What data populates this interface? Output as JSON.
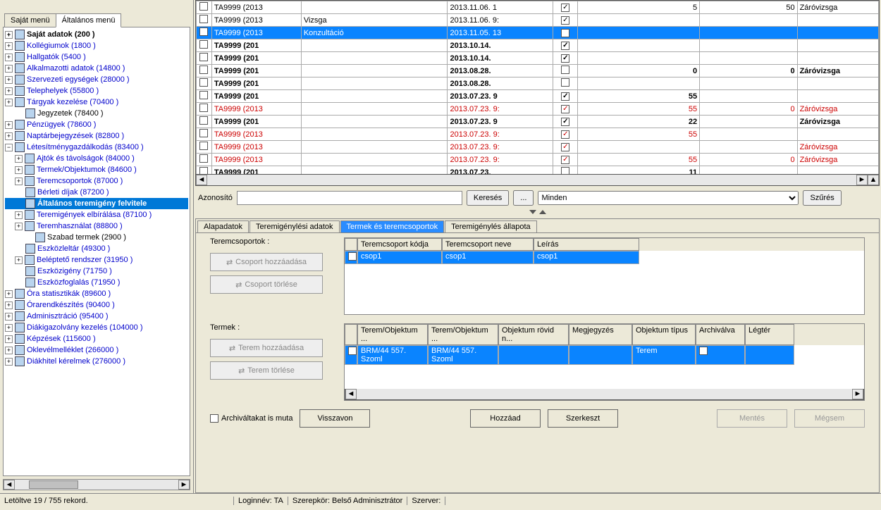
{
  "tabs": {
    "own": "Saját menü",
    "general": "Általános menü"
  },
  "tree": [
    {
      "d": 0,
      "e": "+",
      "bold": true,
      "black": true,
      "t": "Saját adatok (200  )"
    },
    {
      "d": 0,
      "e": "+",
      "t": "Kollégiumok (1800  )"
    },
    {
      "d": 0,
      "e": "+",
      "t": "Hallgatók (5400  )"
    },
    {
      "d": 0,
      "e": "+",
      "t": "Alkalmazotti adatok (14800  )"
    },
    {
      "d": 0,
      "e": "+",
      "t": "Szervezeti egységek (28000  )"
    },
    {
      "d": 0,
      "e": "+",
      "t": "Telephelyek (55800  )"
    },
    {
      "d": 0,
      "e": "+",
      "t": "Tárgyak kezelése (70400  )"
    },
    {
      "d": 1,
      "e": "",
      "black": true,
      "t": "Jegyzetek (78400  )"
    },
    {
      "d": 0,
      "e": "+",
      "t": "Pénzügyek (78600  )"
    },
    {
      "d": 0,
      "e": "+",
      "t": "Naptárbejegyzések (82800  )"
    },
    {
      "d": 0,
      "e": "−",
      "t": "Létesítménygazdálkodás (83400  )"
    },
    {
      "d": 1,
      "e": "+",
      "t": "Ajtók és távolságok (84000  )"
    },
    {
      "d": 1,
      "e": "+",
      "t": "Termek/Objektumok (84600  )"
    },
    {
      "d": 1,
      "e": "+",
      "t": "Teremcsoportok (87000  )"
    },
    {
      "d": 1,
      "e": "",
      "t": "Bérleti díjak (87200  )"
    },
    {
      "d": 1,
      "e": "",
      "sel": true,
      "bold": true,
      "t": "Általános teremigény felvitele"
    },
    {
      "d": 1,
      "e": "+",
      "t": "Teremigények elbírálása (87100  )"
    },
    {
      "d": 1,
      "e": "+",
      "t": "Teremhasználat (88800  )"
    },
    {
      "d": 2,
      "e": "",
      "black": true,
      "t": "Szabad termek (2900  )"
    },
    {
      "d": 1,
      "e": "",
      "t": "Eszközleltár (49300  )"
    },
    {
      "d": 1,
      "e": "+",
      "t": "Beléptető rendszer (31950  )"
    },
    {
      "d": 1,
      "e": "",
      "t": "Eszközigény (71750  )"
    },
    {
      "d": 1,
      "e": "",
      "t": "Eszközfoglalás (71950  )"
    },
    {
      "d": 0,
      "e": "+",
      "t": "Óra statisztikák (89600  )"
    },
    {
      "d": 0,
      "e": "+",
      "t": "Órarendkészítés (90400  )"
    },
    {
      "d": 0,
      "e": "+",
      "t": "Adminisztráció (95400  )"
    },
    {
      "d": 0,
      "e": "+",
      "t": "Diákigazolvány kezelés (104000  )"
    },
    {
      "d": 0,
      "e": "+",
      "t": "Képzések (115600  )"
    },
    {
      "d": 0,
      "e": "+",
      "t": "Oklevélmelléklet (266000  )"
    },
    {
      "d": 0,
      "e": "+",
      "t": "Diákhitel kérelmek (276000  )"
    }
  ],
  "grid": [
    {
      "c1": "TA9999 (2013",
      "c2": "",
      "c3": "2013.11.06. 1",
      "ck": true,
      "c5": "5",
      "c6": "50",
      "c7": "Záróvizsga"
    },
    {
      "c1": "TA9999 (2013",
      "c2": "Vizsga",
      "c3": "2013.11.06. 9:",
      "ck": true,
      "c5": "",
      "c6": "",
      "c7": ""
    },
    {
      "sel": true,
      "c1": "TA9999 (2013",
      "c2": "Konzultáció",
      "c3": "2013.11.05. 13",
      "ck": true,
      "c5": "",
      "c6": "",
      "c7": ""
    },
    {
      "bold": true,
      "c1": "TA9999 (201",
      "c2": "",
      "c3": "2013.10.14.",
      "ck": true,
      "c5": "",
      "c6": "",
      "c7": ""
    },
    {
      "bold": true,
      "c1": "TA9999 (201",
      "c2": "",
      "c3": "2013.10.14.",
      "ck": true,
      "c5": "",
      "c6": "",
      "c7": ""
    },
    {
      "bold": true,
      "c1": "TA9999 (201",
      "c2": "",
      "c3": "2013.08.28.",
      "ck": false,
      "c5": "0",
      "c6": "0",
      "c7": "Záróvizsga"
    },
    {
      "bold": true,
      "c1": "TA9999 (201",
      "c2": "",
      "c3": "2013.08.28.",
      "ck": false,
      "c5": "",
      "c6": "",
      "c7": ""
    },
    {
      "bold": true,
      "c1": "TA9999 (201",
      "c2": "",
      "c3": "2013.07.23. 9",
      "ck": true,
      "c5": "55",
      "c6": "",
      "c7": ""
    },
    {
      "red": true,
      "c1": "TA9999 (2013",
      "c2": "",
      "c3": "2013.07.23. 9:",
      "ck": true,
      "c5": "55",
      "c6": "0",
      "c7": "Záróvizsga"
    },
    {
      "bold": true,
      "c1": "TA9999 (201",
      "c2": "",
      "c3": "2013.07.23. 9",
      "ck": true,
      "c5": "22",
      "c6": "",
      "c7": "Záróvizsga"
    },
    {
      "red": true,
      "c1": "TA9999 (2013",
      "c2": "",
      "c3": "2013.07.23. 9:",
      "ck": true,
      "c5": "55",
      "c6": "",
      "c7": ""
    },
    {
      "red": true,
      "c1": "TA9999 (2013",
      "c2": "",
      "c3": "2013.07.23. 9:",
      "ck": true,
      "c5": "",
      "c6": "",
      "c7": "Záróvizsga"
    },
    {
      "red": true,
      "c1": "TA9999 (2013",
      "c2": "",
      "c3": "2013.07.23. 9:",
      "ck": true,
      "c5": "55",
      "c6": "0",
      "c7": "Záróvizsga"
    },
    {
      "bold": true,
      "c1": "TA9999 (201",
      "c2": "",
      "c3": "2013.07.23.",
      "ck": false,
      "c5": "11",
      "c6": "",
      "c7": ""
    }
  ],
  "search": {
    "label": "Azonosító",
    "btn": "Keresés",
    "dots": "...",
    "sel": "Minden",
    "filter": "Szűrés"
  },
  "subtabs": {
    "t1": "Alapadatok",
    "t2": "Teremigénylési adatok",
    "t3": "Termek és teremcsoportok",
    "t4": "Teremigénylés állapota"
  },
  "groups": {
    "g1label": "Teremcsoportok :",
    "g1btn1": "Csoport hozzáadása",
    "g1btn2": "Csoport törlése",
    "g1head": [
      "Teremcsoport kódja",
      "Teremcsoport neve",
      "Leírás"
    ],
    "g1row": [
      "csop1",
      "csop1",
      "csop1"
    ],
    "g2label": "Termek :",
    "g2btn1": "Terem hozzáadása",
    "g2btn2": "Terem törlése",
    "g2head": [
      "Terem/Objektum ...",
      "Terem/Objektum ...",
      "Objektum rövid n...",
      "Megjegyzés",
      "Objektum típus",
      "Archiválva",
      "Légtér"
    ],
    "g2row": [
      "BRM/44 557. Szoml",
      "BRM/44 557. Szoml",
      "",
      "",
      "Terem",
      "",
      ""
    ]
  },
  "bottom": {
    "arch": "Archiváltakat is muta",
    "undo": "Visszavon",
    "add": "Hozzáad",
    "edit": "Szerkeszt",
    "save": "Mentés",
    "cancel": "Mégsem"
  },
  "status": {
    "rec": "Letöltve 19 / 755 rekord.",
    "login": "Loginnév: TA",
    "role": "Szerepkör: Belső Adminisztrátor",
    "srv": "Szerver:"
  }
}
